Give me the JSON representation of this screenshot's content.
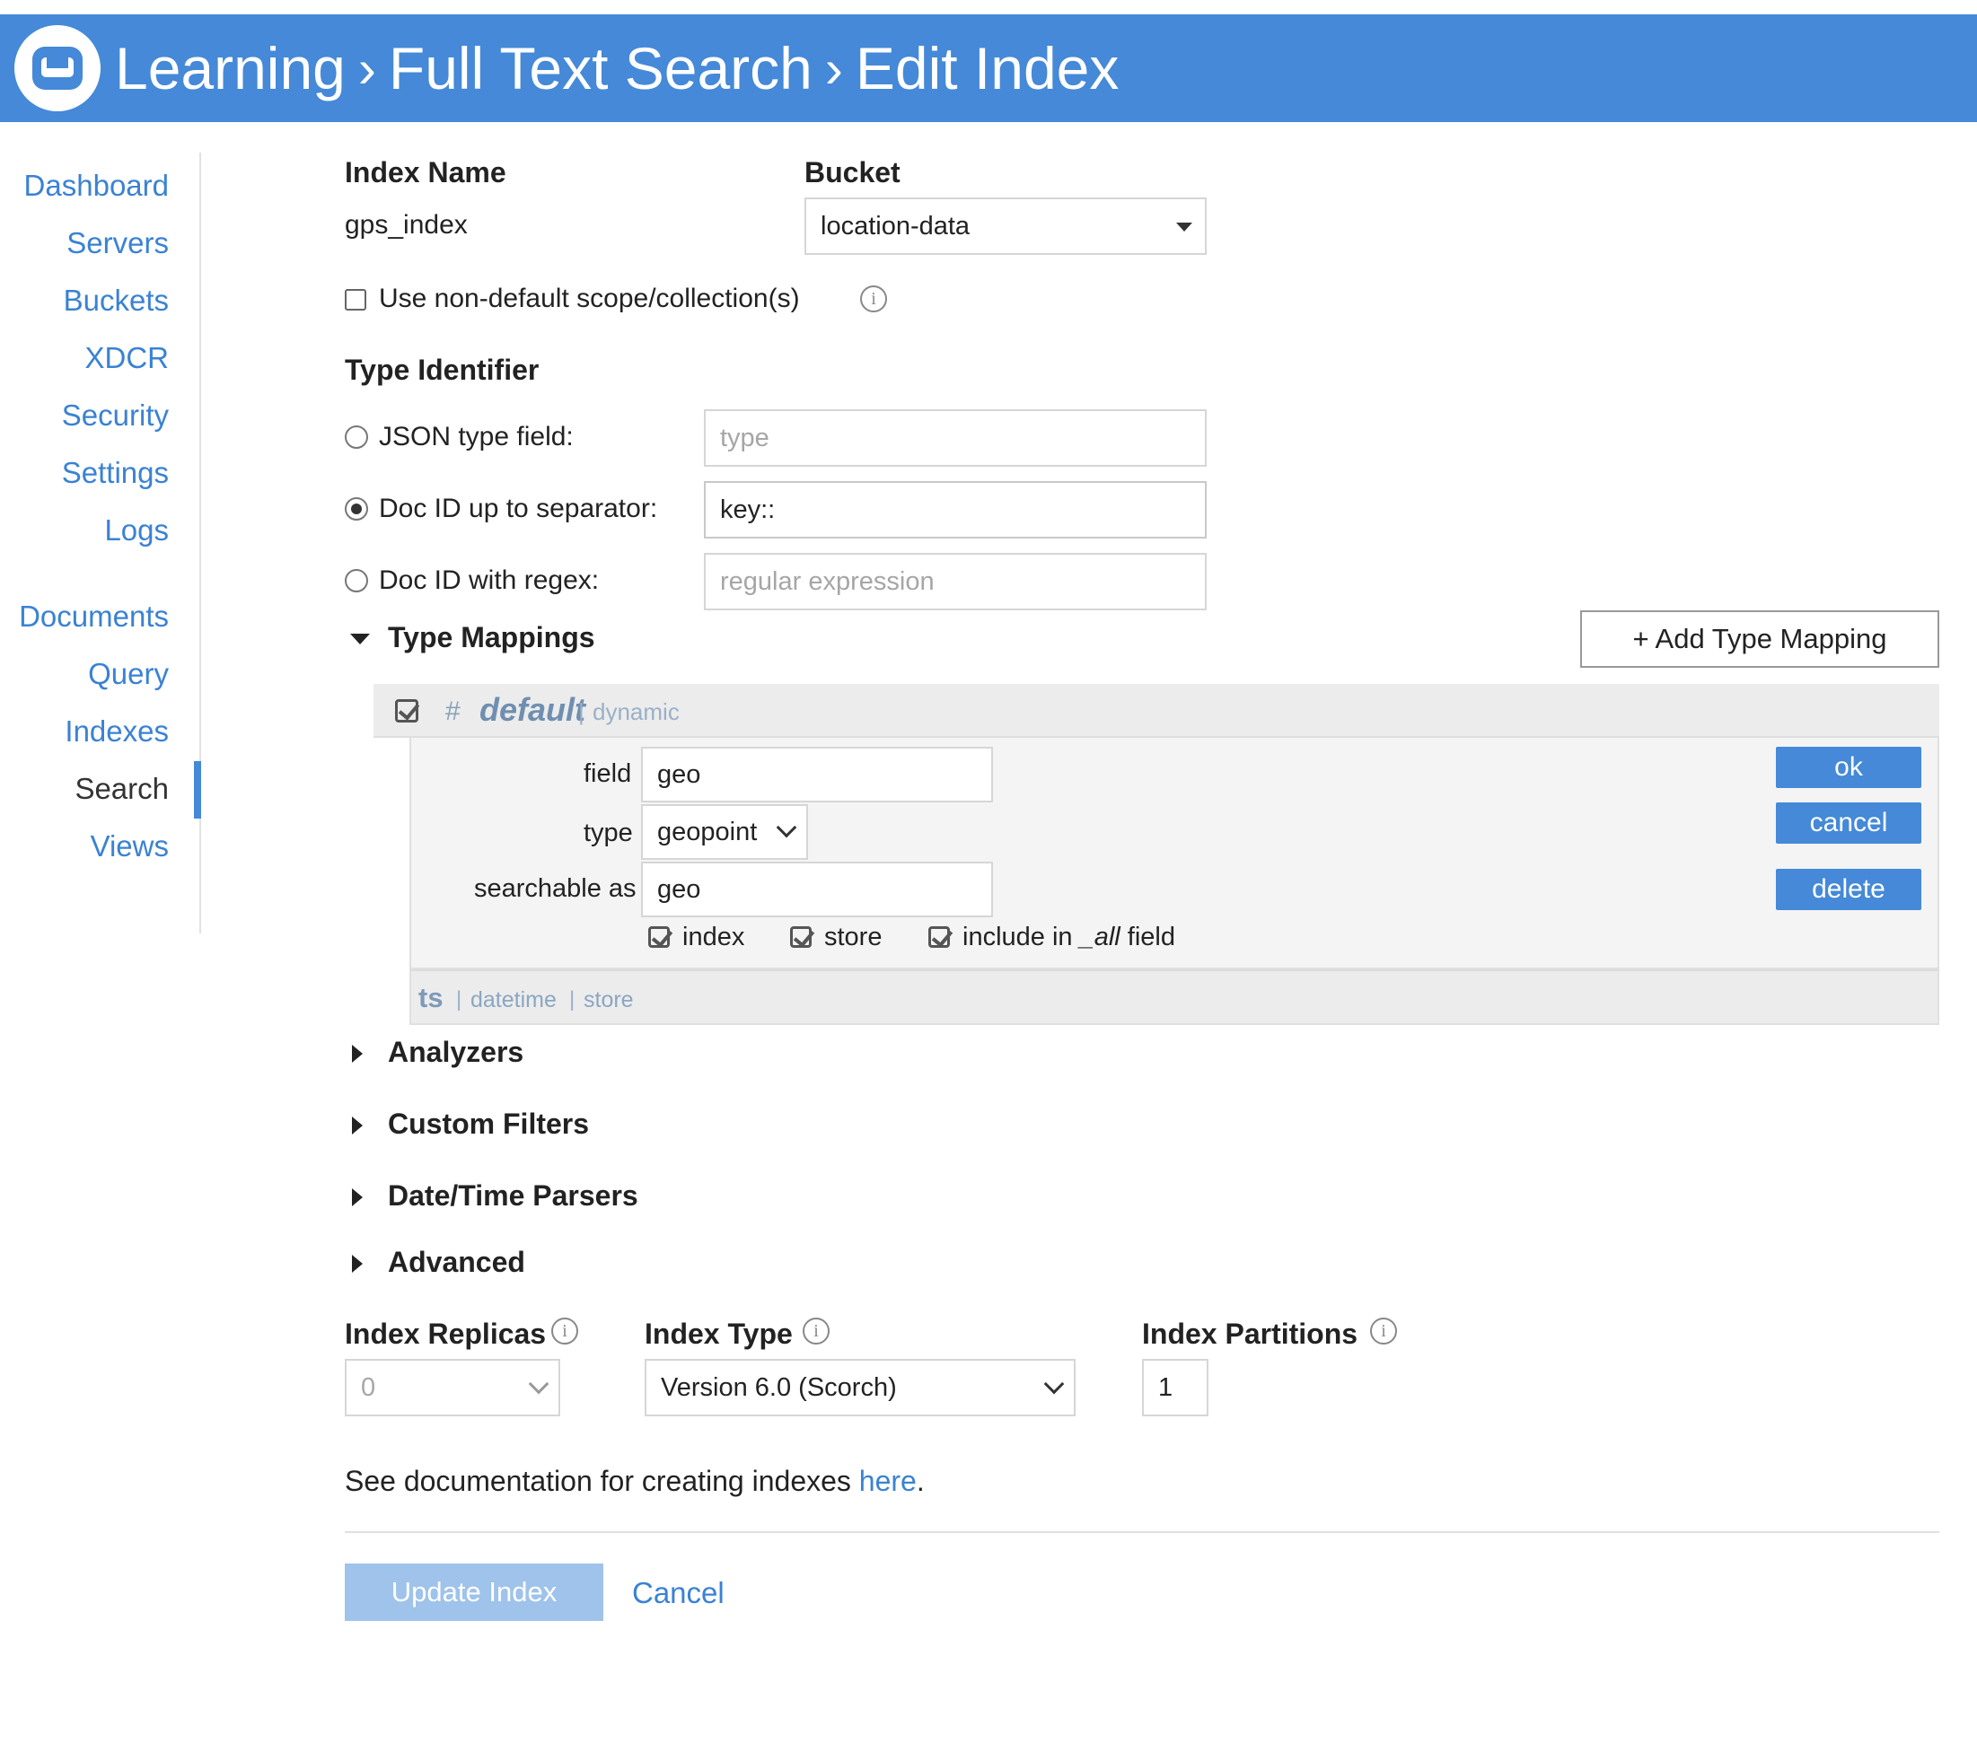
{
  "header": {
    "crumbs": [
      "Learning",
      "Full Text Search",
      "Edit Index"
    ]
  },
  "sidebar": {
    "items": [
      {
        "label": "Dashboard"
      },
      {
        "label": "Servers"
      },
      {
        "label": "Buckets"
      },
      {
        "label": "XDCR"
      },
      {
        "label": "Security"
      },
      {
        "label": "Settings"
      },
      {
        "label": "Logs"
      },
      {
        "label": "Documents"
      },
      {
        "label": "Query"
      },
      {
        "label": "Indexes"
      },
      {
        "label": "Search"
      },
      {
        "label": "Views"
      }
    ],
    "active": "Search"
  },
  "form": {
    "index_name_label": "Index Name",
    "index_name_value": "gps_index",
    "bucket_label": "Bucket",
    "bucket_value": "location-data",
    "scope_checkbox_label": "Use non-default scope/collection(s)",
    "scope_checkbox_checked": false,
    "type_identifier_label": "Type Identifier",
    "type_identifier_options": [
      {
        "label": "JSON type field:",
        "value": "",
        "placeholder": "type",
        "selected": false
      },
      {
        "label": "Doc ID up to separator:",
        "value": "key::",
        "placeholder": "",
        "selected": true
      },
      {
        "label": "Doc ID with regex:",
        "value": "",
        "placeholder": "regular expression",
        "selected": false
      }
    ],
    "type_mappings_label": "Type Mappings",
    "add_type_mapping_label": "+ Add Type Mapping"
  },
  "mapping": {
    "hash": "#",
    "name": "default",
    "sep": "|",
    "mode": "dynamic",
    "field_label": "field",
    "field_value": "geo",
    "type_label": "type",
    "type_value": "geopoint",
    "searchable_label": "searchable as",
    "searchable_value": "geo",
    "opt_index": "index",
    "opt_store": "store",
    "opt_include_prefix": "include in ",
    "opt_include_all": "_all",
    "opt_include_suffix": " field",
    "ok_label": "ok",
    "cancel_label": "cancel",
    "delete_label": "delete",
    "sub_field_name": "ts",
    "sub_field_type": "datetime",
    "sub_field_flag": "store"
  },
  "sections": [
    "Analyzers",
    "Custom Filters",
    "Date/Time Parsers",
    "Advanced"
  ],
  "settings": {
    "replicas_label": "Index Replicas",
    "replicas_value": "0",
    "index_type_label": "Index Type",
    "index_type_value": "Version 6.0 (Scorch)",
    "partitions_label": "Index Partitions",
    "partitions_value": "1"
  },
  "footer": {
    "doc_text": "See documentation for creating indexes ",
    "doc_link": "here",
    "doc_period": ".",
    "update_label": "Update Index",
    "cancel_label": "Cancel"
  },
  "colors": {
    "header_bg": "#4589d8",
    "link": "#3a82d3",
    "primary_disabled": "#9fc3ea"
  }
}
